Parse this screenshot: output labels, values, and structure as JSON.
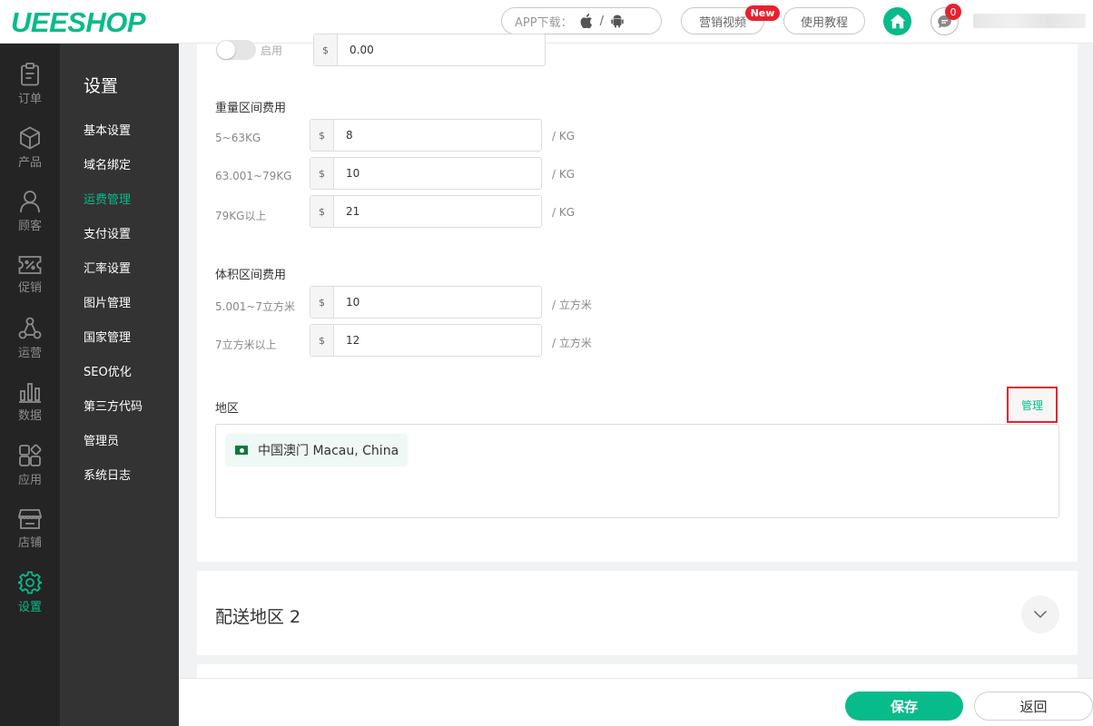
{
  "header": {
    "logo": "UEESHOP",
    "app_download_label": "APP下载：",
    "app_separator": "/",
    "marketing_video_label": "营销视频",
    "new_badge": "New",
    "tutorial_label": "使用教程",
    "message_count": "0"
  },
  "icon_sidebar": {
    "items": [
      {
        "label": "订单",
        "icon": "clipboard-icon"
      },
      {
        "label": "产品",
        "icon": "box-icon"
      },
      {
        "label": "顾客",
        "icon": "user-icon"
      },
      {
        "label": "促销",
        "icon": "percent-ticket-icon"
      },
      {
        "label": "运营",
        "icon": "share-nodes-icon"
      },
      {
        "label": "数据",
        "icon": "bar-chart-icon"
      },
      {
        "label": "应用",
        "icon": "apps-icon"
      },
      {
        "label": "店铺",
        "icon": "store-icon"
      },
      {
        "label": "设置",
        "icon": "gear-icon"
      }
    ],
    "active_index": 8
  },
  "sub_sidebar": {
    "title": "设置",
    "items": [
      "基本设置",
      "域名绑定",
      "运费管理",
      "支付设置",
      "汇率设置",
      "图片管理",
      "国家管理",
      "SEO优化",
      "第三方代码",
      "管理员",
      "系统日志"
    ],
    "active_index": 2
  },
  "main": {
    "enable_toggle": {
      "label": "启用",
      "on": false
    },
    "base_fee": {
      "prefix": "$",
      "value": "0.00"
    },
    "weight_section": {
      "title": "重量区间费用",
      "rows": [
        {
          "label": "5~63KG",
          "prefix": "$",
          "value": "8",
          "unit": "/ KG"
        },
        {
          "label": "63.001~79KG",
          "prefix": "$",
          "value": "10",
          "unit": "/ KG"
        },
        {
          "label": "79KG以上",
          "prefix": "$",
          "value": "21",
          "unit": "/ KG"
        }
      ]
    },
    "volume_section": {
      "title": "体积区间费用",
      "rows": [
        {
          "label": "5.001~7立方米",
          "prefix": "$",
          "value": "10",
          "unit": "/ 立方米"
        },
        {
          "label": "7立方米以上",
          "prefix": "$",
          "value": "12",
          "unit": "/ 立方米"
        }
      ]
    },
    "region": {
      "title": "地区",
      "manage_label": "管理",
      "tags": [
        {
          "name": "中国澳门  Macau, China",
          "flag": "macau-flag-icon"
        }
      ]
    },
    "zone2": {
      "title": "配送地区 2"
    }
  },
  "footer": {
    "save_label": "保存",
    "back_label": "返回"
  },
  "colors": {
    "accent": "#07bb8a",
    "badge": "#e8202e",
    "sidebar_dark": "#242424",
    "sidebar": "#333333"
  }
}
